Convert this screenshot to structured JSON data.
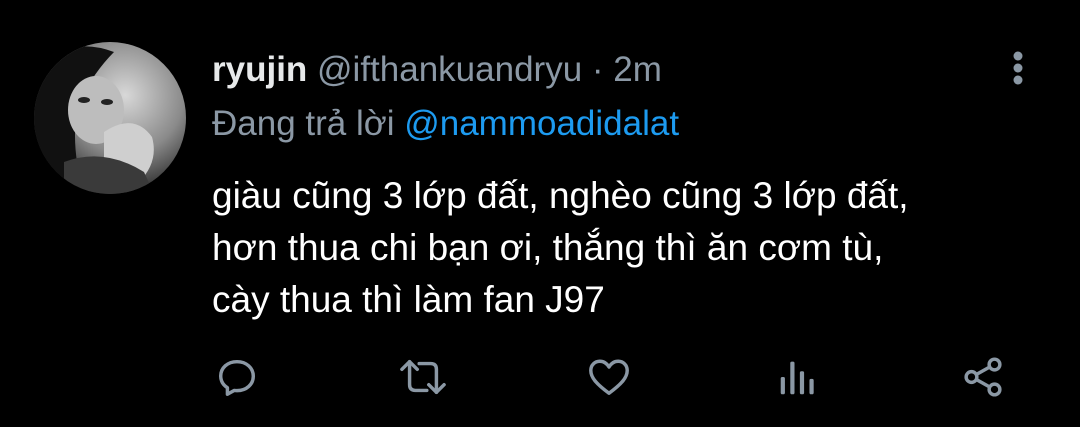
{
  "tweet": {
    "display_name": "ryujin",
    "handle": "@ifthankuandryu",
    "separator": "·",
    "time": "2m",
    "reply_prefix": "Đang trả lời",
    "reply_mention": "@nammoadidalat",
    "text_lines": [
      "giàu cũng 3 lớp đất, nghèo cũng 3 lớp đất,",
      "hơn thua chi bạn ơi, thắng thì ăn cơm tù,",
      "cày thua thì làm fan J97"
    ]
  },
  "actions": [
    "reply-icon",
    "retweet-icon",
    "like-icon",
    "analytics-icon",
    "share-icon"
  ],
  "colors": {
    "background": "#000000",
    "text": "#ffffff",
    "secondary": "#8b98a5",
    "accent": "#1d9bf0"
  }
}
